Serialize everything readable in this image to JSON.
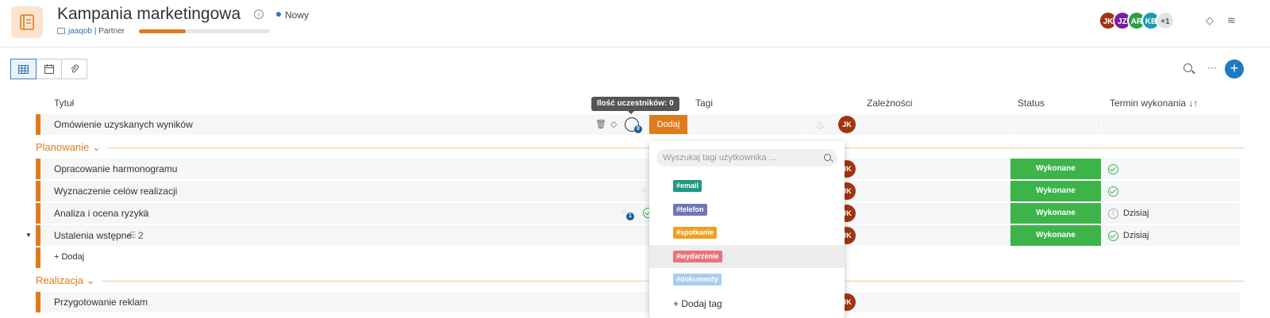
{
  "header": {
    "title": "Kampania marketingowa",
    "info_icon": "i",
    "status": "Nowy",
    "status_color": "#3b6fc9",
    "owner": "jaaqob",
    "separator": "|",
    "role": "Partner",
    "progress": 0.36,
    "avatars": [
      {
        "initials": "JK",
        "color": "#a0360e"
      },
      {
        "initials": "JZ",
        "color": "#7a1fa2"
      },
      {
        "initials": "AR",
        "color": "#2e9e48"
      },
      {
        "initials": "KB",
        "color": "#1a9bb0"
      },
      {
        "initials": "+1",
        "color": "#e3e3e3"
      }
    ]
  },
  "columns": {
    "title": "Tytuł",
    "tags": "Tagi",
    "dependencies": "Zależności",
    "status": "Status",
    "due": "Termin wykonania ↓↑"
  },
  "tooltip": "Ilość uczestników: 0",
  "dodaj_button": "Dodaj",
  "rows": {
    "first": {
      "label": "Omówienie uzyskanych wyników",
      "participants": "0"
    },
    "section_planning": "Planowanie ⌄",
    "r1": {
      "label": "Opracowanie harmonogramu",
      "status": "Wykonane"
    },
    "r2": {
      "label": "Wyznaczenie celów realizacji",
      "status": "Wykonane"
    },
    "r3": {
      "label": "Analiza i ocena ryzyka",
      "status": "Wykonane",
      "due": "Dzisiaj",
      "comments": "1"
    },
    "r4": {
      "label": "Ustalenia wstępne",
      "status": "Wykonane",
      "due": "Dzisiaj",
      "subtasks": "2"
    },
    "add_row": "+ Dodaj",
    "section_realization": "Realizacja ⌄",
    "r5": {
      "label": "Przygotowanie reklam"
    }
  },
  "assignee_initials": "JK",
  "dropdown": {
    "search_placeholder": "Wyszukaj tagi użytkownika ...",
    "tags": [
      {
        "label": "#email",
        "color": "#1c9a83"
      },
      {
        "label": "#telefon",
        "color": "#6f78b3"
      },
      {
        "label": "#spotkanie",
        "color": "#f0a020"
      },
      {
        "label": "#wydarzenie",
        "color": "#e8737a"
      },
      {
        "label": "#dokumenty",
        "color": "#a8cdf0"
      }
    ],
    "add_tag": "+  Dodaj tag"
  }
}
